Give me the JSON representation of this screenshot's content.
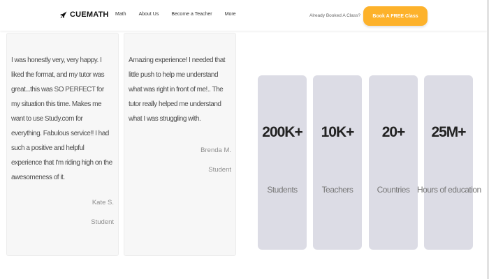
{
  "header": {
    "brand": "CUEMATH",
    "logo_icon": "rocket-icon",
    "nav": [
      "Math",
      "About Us",
      "Become a Teacher",
      "More"
    ],
    "booked_text": "Already Booked A Class?",
    "cta_label": "Book A FREE Class",
    "cta_color": "#fdb22b"
  },
  "testimonials": [
    {
      "quote": "I was honestly very, very happy. I liked the format, and my tutor was great...this was SO PERFECT for my situation this time. Makes me want to use Study.com for everything. Fabulous service!! I had such a positive and helpful experience that I'm riding high on the awesomeness of it.",
      "name": "Kate S.",
      "role": "Student"
    },
    {
      "quote": "Amazing experience! I needed that little push to help me understand what was right in front of me!.. The tutor really helped me understand what I was struggling with.",
      "name": "Brenda M.",
      "role": "Student"
    }
  ],
  "stats": [
    {
      "value": "200K+",
      "label": "Students"
    },
    {
      "value": "10K+",
      "label": "Teachers"
    },
    {
      "value": "20+",
      "label": "Countries"
    },
    {
      "value": "25M+",
      "label": "Hours of education"
    }
  ],
  "colors": {
    "stat_bg": "#dcdce5",
    "card_bg": "#f7f7f7"
  }
}
